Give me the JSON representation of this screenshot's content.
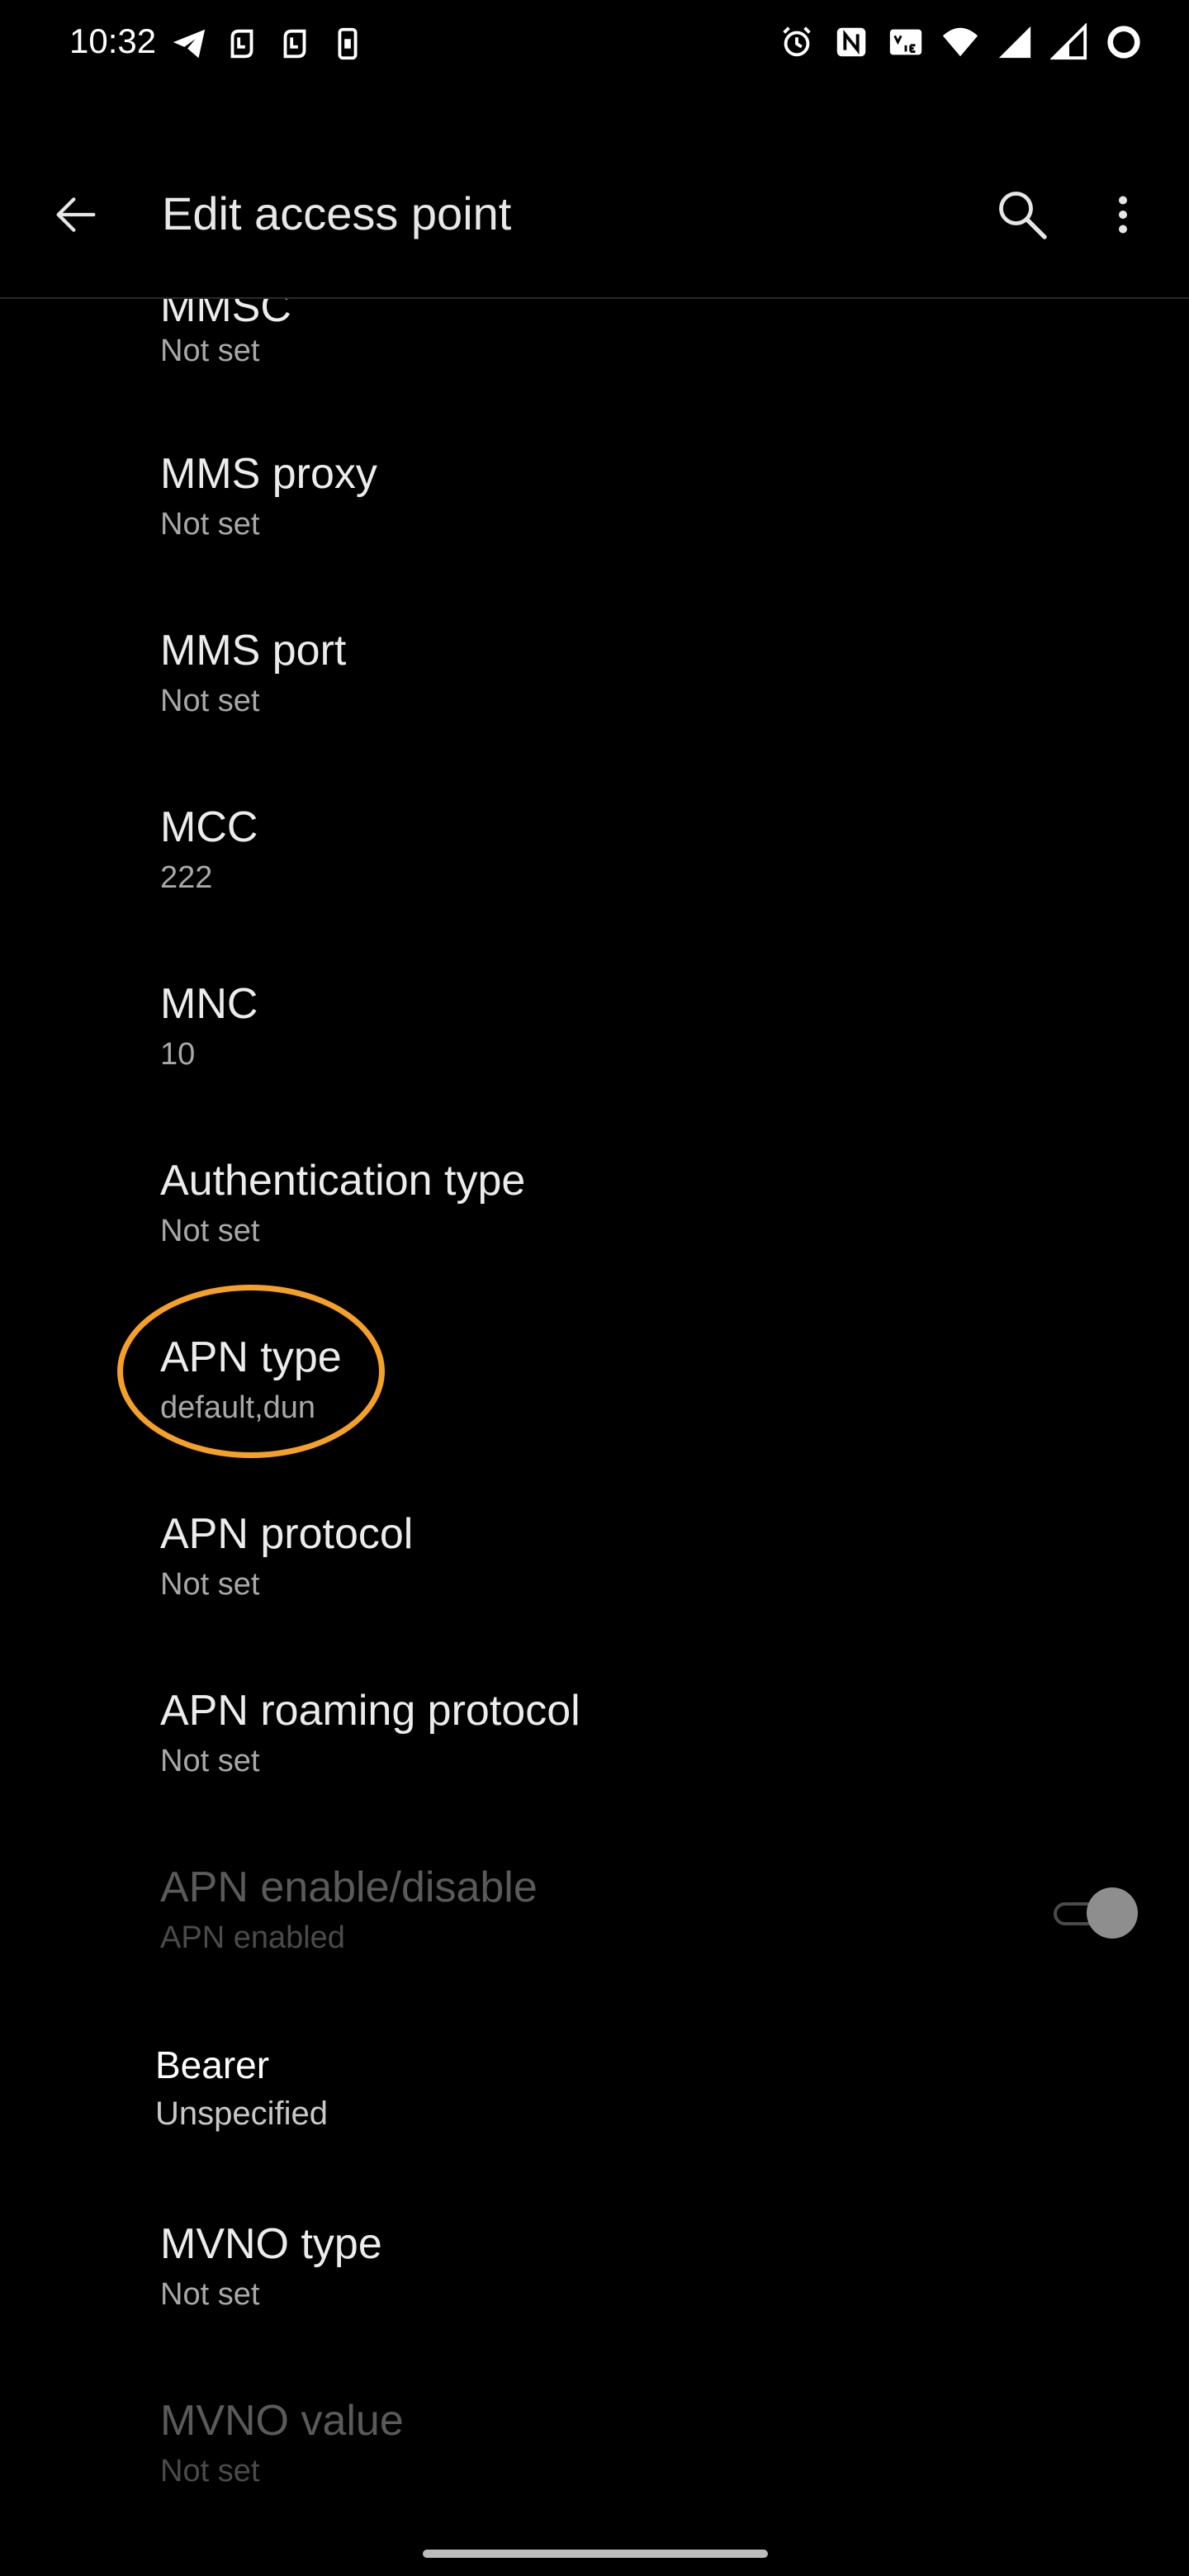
{
  "status_bar": {
    "time": "10:32",
    "left_icons": [
      "telegram-icon",
      "nfc-tag-icon",
      "nfc-tag-icon",
      "phone-vibrate-icon"
    ],
    "right_icons": [
      "alarm-icon",
      "nfc-icon",
      "volte-icon",
      "wifi-icon",
      "signal-icon",
      "signal-icon",
      "battery-ring-icon"
    ]
  },
  "app_bar": {
    "title": "Edit access point",
    "back_icon": "arrow-left-icon",
    "search_icon": "search-icon",
    "more_icon": "more-vert-icon"
  },
  "items": [
    {
      "title": "MMSC",
      "summary": "Not set"
    },
    {
      "title": "MMS proxy",
      "summary": "Not set"
    },
    {
      "title": "MMS port",
      "summary": "Not set"
    },
    {
      "title": "MCC",
      "summary": "222"
    },
    {
      "title": "MNC",
      "summary": "10"
    },
    {
      "title": "Authentication type",
      "summary": "Not set"
    },
    {
      "title": "APN type",
      "summary": "default,dun"
    },
    {
      "title": "APN protocol",
      "summary": "Not set"
    },
    {
      "title": "APN roaming protocol",
      "summary": "Not set"
    },
    {
      "title": "APN enable/disable",
      "summary": "APN enabled",
      "enabled": false,
      "toggle_on": true
    },
    {
      "title": "Bearer",
      "summary": "Unspecified"
    },
    {
      "title": "MVNO type",
      "summary": "Not set"
    },
    {
      "title": "MVNO value",
      "summary": "Not set",
      "enabled": false
    }
  ],
  "colors": {
    "background": "#000000",
    "highlight": "#f5a027"
  }
}
